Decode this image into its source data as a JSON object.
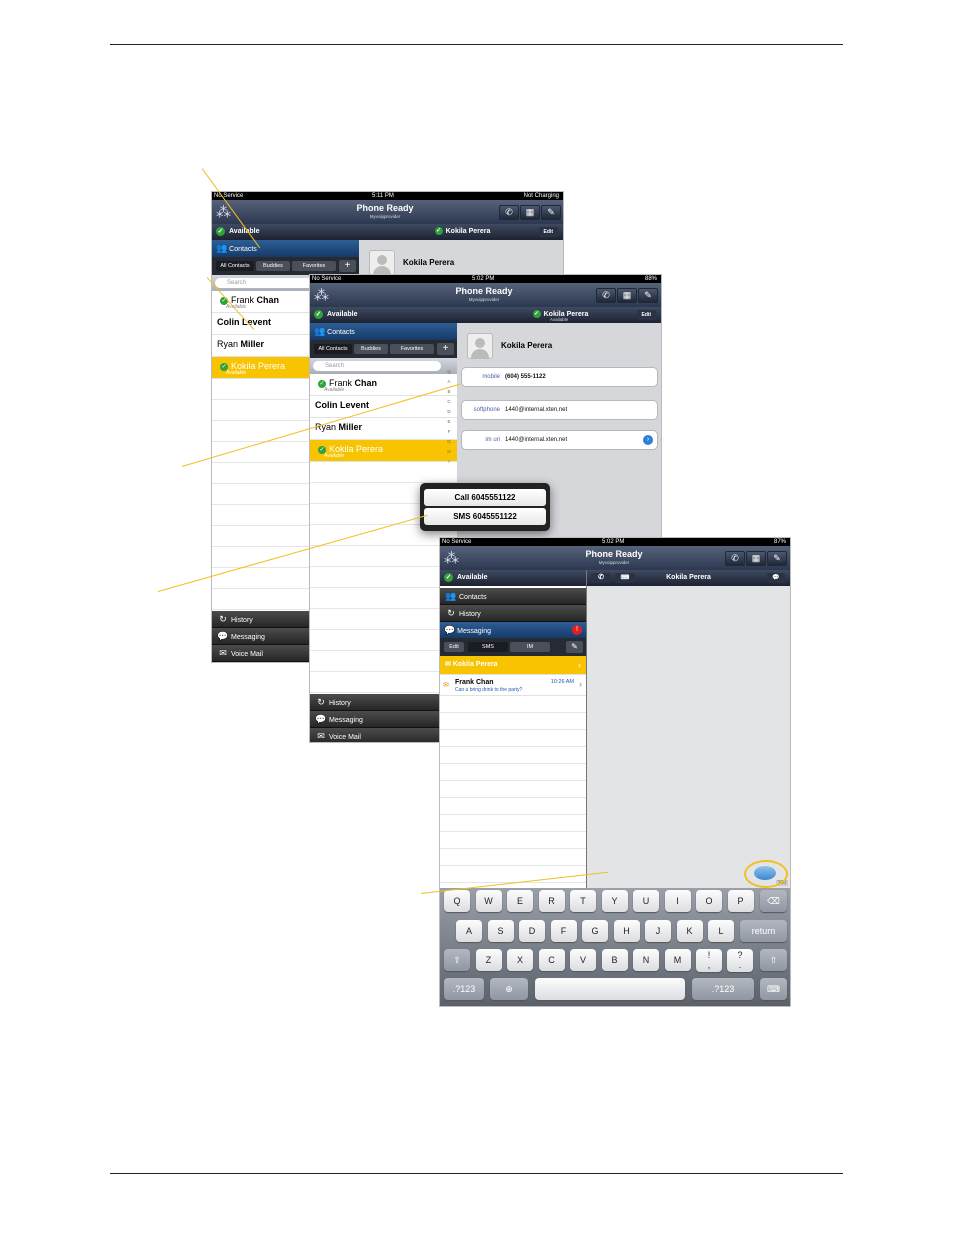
{
  "app": {
    "title": "Phone Ready",
    "subtitle": "Myvoipprovider",
    "presence": "Available",
    "contacts_label": "Contacts",
    "history_label": "History",
    "messaging_label": "Messaging",
    "voicemail_label": "Voice Mail",
    "edit_label": "Edit",
    "search_placeholder": "Search"
  },
  "status": {
    "back": {
      "carrier": "No Service",
      "time": "5:11 PM",
      "battery": "Not Charging"
    },
    "middle": {
      "carrier": "No Service",
      "time": "5:02 PM",
      "battery": "88%"
    },
    "front": {
      "carrier": "No Service",
      "time": "5:02 PM",
      "battery": "87%"
    }
  },
  "tabs": {
    "all": "All Contacts",
    "buddies": "Buddies",
    "favorites": "Favorites",
    "plus": "+"
  },
  "contacts": [
    {
      "first": "Frank",
      "last": "Chan",
      "status": "Available"
    },
    {
      "first": "Colin",
      "last": "Levent",
      "status": ""
    },
    {
      "first": "Ryan",
      "last": "Miller",
      "status": ""
    },
    {
      "first": "Kokila",
      "last": "Perera",
      "status": "Available"
    }
  ],
  "selected_contact": {
    "name": "Kokila Perera",
    "status": "Available",
    "fields": [
      {
        "label": "mobile",
        "value": "(604) 555-1122"
      },
      {
        "label": "softphone",
        "value": "1440@internal.xten.net"
      },
      {
        "label": "im uri",
        "value": "1440@internal.xten.net"
      }
    ]
  },
  "popup": {
    "call": "Call 6045551122",
    "sms": "SMS 6045551122"
  },
  "index_letters": [
    "Q",
    "A",
    "B",
    "C",
    "D",
    "E",
    "F",
    "G",
    "H",
    "I"
  ],
  "messaging": {
    "badge": "!",
    "seg_edit": "Edit",
    "seg_sms": "SMS",
    "seg_im": "IM",
    "conv_header": "Kokila Perera",
    "threads": [
      {
        "name": "Kokila Perera",
        "time": "",
        "preview": ""
      },
      {
        "name": "Frank Chan",
        "time": "10:26 AM",
        "preview": "Can u bring drink to the party?"
      }
    ],
    "counter": "160"
  },
  "keyboard": {
    "row1": [
      "Q",
      "W",
      "E",
      "R",
      "T",
      "Y",
      "U",
      "I",
      "O",
      "P"
    ],
    "row2": [
      "A",
      "S",
      "D",
      "F",
      "G",
      "H",
      "J",
      "K",
      "L"
    ],
    "row3": [
      "Z",
      "X",
      "C",
      "V",
      "B",
      "N",
      "M"
    ],
    "return": "return",
    "num": ".?123",
    "excl_top": "!",
    "excl_bot": ",",
    "q_top": "?",
    "q_bot": "."
  }
}
